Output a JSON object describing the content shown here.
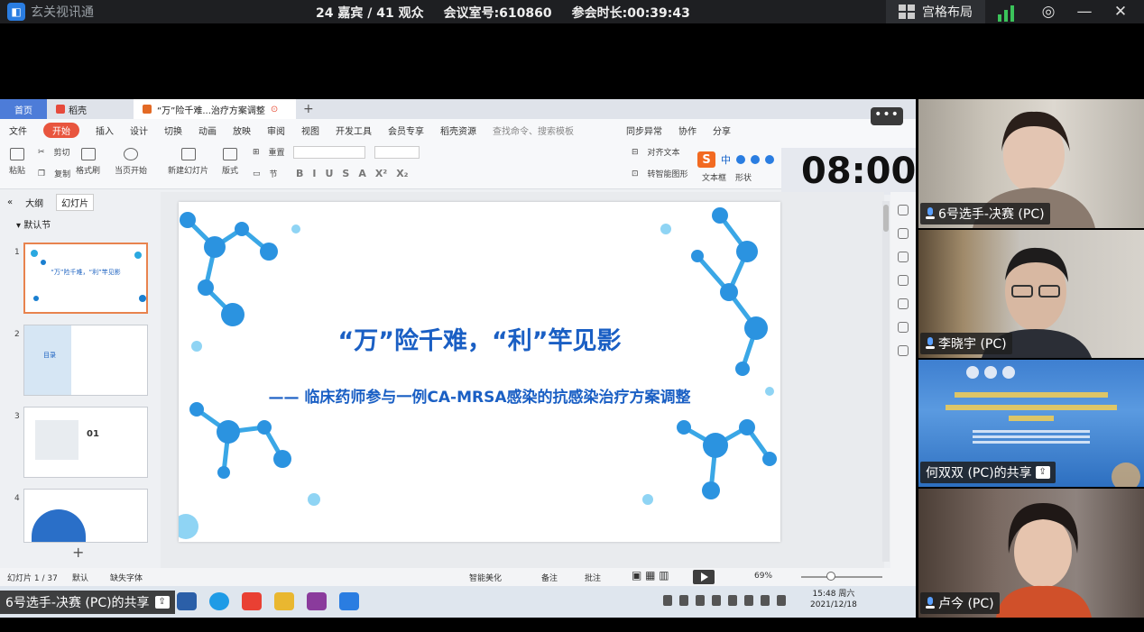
{
  "meeting": {
    "app_name": "玄关视讯通",
    "participants": "24 嘉宾 / 41 观众",
    "room_id": "会议室号:610860",
    "duration": "参会时长:00:39:43",
    "layout_label": "宫格布局"
  },
  "wps": {
    "tabs": {
      "home": "首页",
      "docer": "稻壳",
      "doc": "“万”险千难...治疗方案调整"
    },
    "menu": [
      "文件",
      "开始",
      "插入",
      "设计",
      "切换",
      "动画",
      "放映",
      "审阅",
      "视图",
      "开发工具",
      "会员专享",
      "稻壳资源"
    ],
    "menu_search": "查找命令、搜索模板",
    "menu_right": [
      "同步异常",
      "协作",
      "分享"
    ],
    "ribbon": {
      "paste": "粘贴",
      "cut": "剪切",
      "copy": "复制",
      "format_painter": "格式刷",
      "from_current": "当页开始",
      "new_slide": "新建幻灯片",
      "layout": "版式",
      "section": "节",
      "reset": "重置",
      "text_box": "文本框",
      "shape": "形状",
      "smart_graphic": "转智能图形",
      "align_text": "对齐文本"
    },
    "timer": "08:00",
    "pane_tabs": {
      "outline": "大纲",
      "slides": "幻灯片"
    },
    "section_label": "默认节",
    "thumbnails": [
      {
        "num": "1",
        "title": "“万”险千难，“利”竿见影"
      },
      {
        "num": "2",
        "title": "目录"
      },
      {
        "num": "3",
        "title": "01"
      },
      {
        "num": "4",
        "title": ""
      }
    ],
    "slide": {
      "title": "“万”险千难，“利”竿见影",
      "subtitle": "—— 临床药师参与一例CA-MRSA感染的抗感染治疗方案调整"
    },
    "status": {
      "slide_counter": "幻灯片 1 / 37",
      "theme": "默认",
      "missing_font": "缺失字体",
      "beautify": "智能美化",
      "notes": "备注",
      "comments": "批注",
      "zoom": "69%"
    },
    "clock": {
      "time": "15:48 周六",
      "date": "2021/12/18"
    }
  },
  "share_label": "6号选手-决赛 (PC)的共享",
  "videos": [
    {
      "name": "6号选手-决赛 (PC)"
    },
    {
      "name": "李晓宇 (PC)"
    },
    {
      "name": "何双双 (PC)的共享"
    },
    {
      "name": "卢今 (PC)"
    }
  ],
  "colors": {
    "accent": "#2a7de1",
    "slide_blue": "#1a5fc4",
    "start_tab": "#e8553e",
    "signal": "#3bc35a"
  }
}
